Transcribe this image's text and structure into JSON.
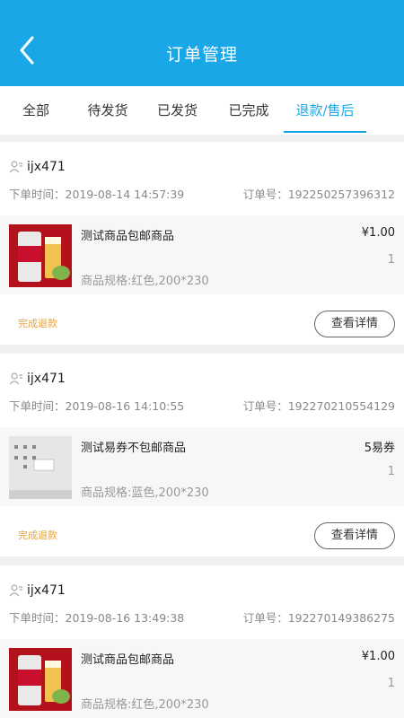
{
  "header": {
    "title": "订单管理",
    "back_icon": "chevron-left-icon"
  },
  "tabs": [
    {
      "label": "全部",
      "active": false
    },
    {
      "label": "待发货",
      "active": false
    },
    {
      "label": "已发货",
      "active": false
    },
    {
      "label": "已完成",
      "active": false
    },
    {
      "label": "退款/售后",
      "active": true
    }
  ],
  "colors": {
    "brand": "#1aa7e8",
    "status": "#e8a23a"
  },
  "orders": [
    {
      "user": "ijx471",
      "time_label": "下单时间：2019-08-14 14:57:39",
      "order_no_label": "订单号：192250257396312",
      "product": {
        "name": "测试商品包邮商品",
        "price": "¥1.00",
        "qty": "1",
        "spec": "商品规格:红色,200*230",
        "image": "beer-can-image"
      },
      "status": "完成退款",
      "detail_button": "查看详情"
    },
    {
      "user": "ijx471",
      "time_label": "下单时间：2019-08-16 14:10:55",
      "order_no_label": "订单号：192270210554129",
      "product": {
        "name": "测试易券不包邮商品",
        "price": "5易券",
        "qty": "1",
        "spec": "商品规格:蓝色,200*230",
        "image": "desktop-screenshot-image"
      },
      "status": "完成退款",
      "detail_button": "查看详情"
    },
    {
      "user": "ijx471",
      "time_label": "下单时间：2019-08-16 13:49:38",
      "order_no_label": "订单号：192270149386275",
      "product": {
        "name": "测试商品包邮商品",
        "price": "¥1.00",
        "qty": "1",
        "spec": "商品规格:红色,200*230",
        "image": "beer-can-image"
      }
    }
  ]
}
